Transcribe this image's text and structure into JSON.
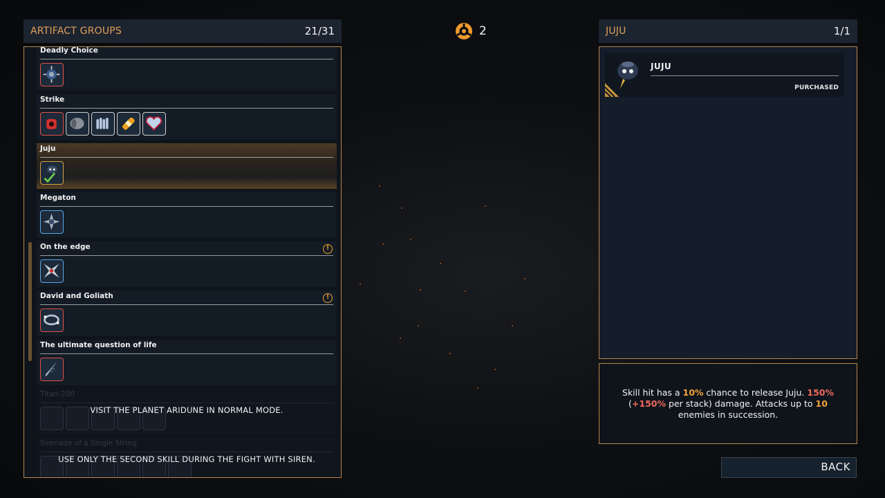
{
  "left_panel": {
    "title": "ARTIFACT GROUPS",
    "count": "21/31",
    "groups": [
      {
        "name": "Deadly Choice",
        "icons": [
          "spiked-orb-icon"
        ]
      },
      {
        "name": "Strike",
        "icons": [
          "red-grenade-icon",
          "barrel-icon",
          "bullets-icon",
          "bandage-icon",
          "heart-icon"
        ]
      },
      {
        "name": "Juju",
        "icons": [
          "juju-icon"
        ]
      },
      {
        "name": "Megaton",
        "icons": [
          "star-badge-icon"
        ]
      },
      {
        "name": "On the edge",
        "icons": [
          "shuriken-icon"
        ],
        "warning": "!"
      },
      {
        "name": "David and Goliath",
        "icons": [
          "ring-icon"
        ],
        "warning": "!"
      },
      {
        "name": "The ultimate question of life",
        "icons": [
          "drill-icon"
        ]
      },
      {
        "name": "Titan-200",
        "locked_message": "VISIT THE PLANET ARIDUNE IN NORMAL MODE."
      },
      {
        "name": "Sirenade of a Single String",
        "locked_message": "USE ONLY THE SECOND SKILL DURING THE FIGHT WITH SIREN."
      }
    ]
  },
  "currency": {
    "count": "2",
    "icon": "gear-token-icon"
  },
  "right_panel": {
    "title": "JUJU",
    "count": "1/1",
    "item": {
      "name": "JUJU",
      "status": "PURCHASED"
    }
  },
  "description": {
    "p1": "Skill hit has a ",
    "v1": "10%",
    "p2": " chance to release Juju. ",
    "v2": "150%",
    "p3": " (",
    "v3": "+150%",
    "p4": " per stack) damage. Attacks up to ",
    "v4": "10",
    "p5": " enemies in succession."
  },
  "back_label": "BACK",
  "colors": {
    "accent": "#b8874d",
    "title": "#e1a05a",
    "highlight": "#f2a33c",
    "red": "#f06a5c"
  }
}
